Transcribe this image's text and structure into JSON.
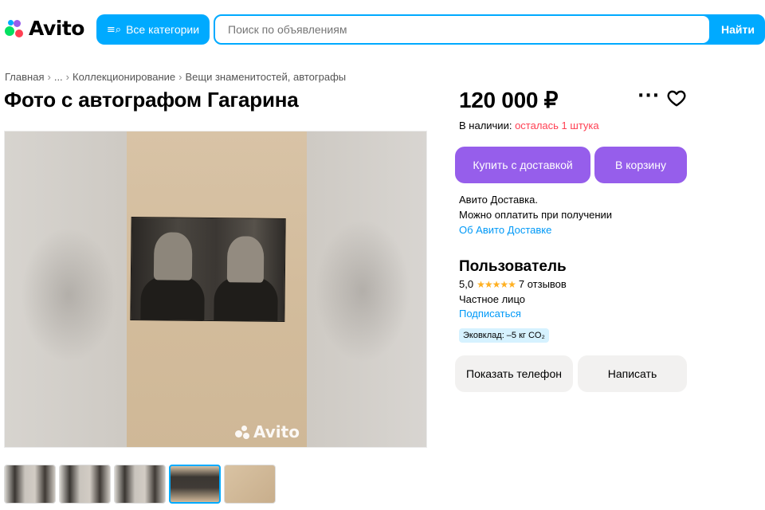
{
  "header": {
    "logo_text": "Avito",
    "categories_label": "Все категории",
    "search_placeholder": "Поиск по объявлениям",
    "search_button": "Найти"
  },
  "breadcrumbs": [
    "Главная",
    "...",
    "Коллекционирование",
    "Вещи знаменитостей, автографы"
  ],
  "breadcrumb_separator": "›",
  "listing": {
    "title": "Фото с автографом Гагарина",
    "price": "120 000 ₽",
    "stock_label": "В наличии:",
    "stock_value": "осталась 1 штука",
    "buy_button": "Купить с доставкой",
    "cart_button": "В корзину",
    "delivery_line1": "Авито Доставка.",
    "delivery_line2": "Можно оплатить при получении",
    "delivery_link": "Об Авито Доставке",
    "watermark": "Avito"
  },
  "seller": {
    "name": "Пользователь",
    "rating": "5,0",
    "stars": "★★★★★",
    "reviews": "7 отзывов",
    "type": "Частное лицо",
    "subscribe": "Подписаться",
    "eco_badge": "Эковклад: –5 кг CO₂",
    "phone_button": "Показать телефон",
    "write_button": "Написать"
  },
  "gallery": {
    "thumbnail_count": 5,
    "active_index": 3
  },
  "colors": {
    "accent_blue": "#00aaff",
    "purple": "#965eeb",
    "red": "#ff4053",
    "link": "#0099f7",
    "star": "#ffb021"
  },
  "icons": {
    "more": "more-icon",
    "favorite": "heart-icon",
    "categories": "categories-search-icon"
  }
}
